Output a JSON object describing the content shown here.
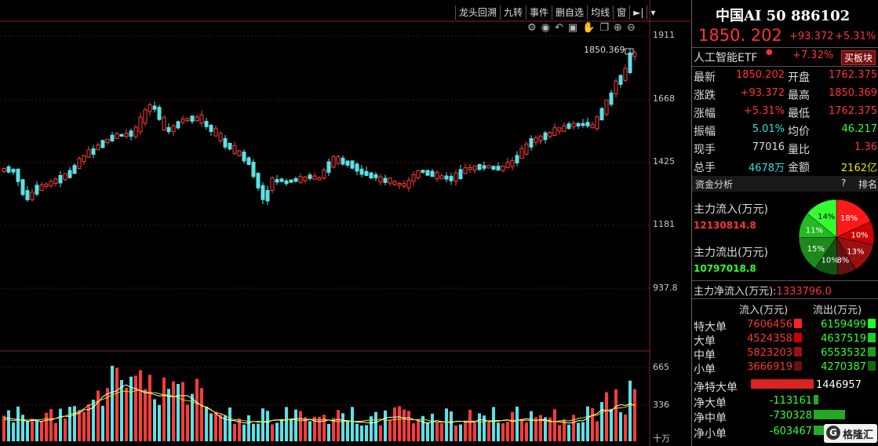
{
  "toolbar": {
    "items": [
      "龙头回溯",
      "九转",
      "事件",
      "删自选",
      "均线",
      "窗"
    ]
  },
  "price_axis": {
    "labels": [
      "1911",
      "1668",
      "1425",
      "1181",
      "937.8"
    ]
  },
  "volume_axis": {
    "labels": [
      "665",
      "336",
      "十万"
    ]
  },
  "chart_marks": {
    "high_label": "1850.369"
  },
  "header": {
    "title": "中国AI 50 886102",
    "price": "1850. 202",
    "change": "+93.372",
    "change_pct": "+5.31%"
  },
  "related": {
    "name": "人工智能ETF",
    "pct": "+7.32%",
    "button": "买板块"
  },
  "quote": [
    {
      "l1": "最新",
      "v1": "1850.202",
      "l2": "开盘",
      "v2": "1762.375"
    },
    {
      "l1": "涨跌",
      "v1": "+93.372",
      "l2": "最高",
      "v2": "1850.369"
    },
    {
      "l1": "涨幅",
      "v1": "+5.31%",
      "l2": "最低",
      "v2": "1762.375"
    },
    {
      "l1": "振幅",
      "v1": "5.01%",
      "l2": "均价",
      "v2": "46.217"
    },
    {
      "l1": "现手",
      "v1": "77016",
      "l2": "量比",
      "v2": "1.36"
    },
    {
      "l1": "总手",
      "v1": "4678万",
      "l2": "金额",
      "v2": "2162亿"
    }
  ],
  "fund": {
    "section_title": "资金分析",
    "help": "?",
    "rank": "排名",
    "inflow_label": "主力流入(万元)",
    "inflow_value": "12130814.8",
    "outflow_label": "主力流出(万元)",
    "outflow_value": "10797018.8",
    "net_label": "主力净流入(万元):",
    "net_value": "1333796.0",
    "pie": [
      {
        "label": "18%",
        "value": 18,
        "color": "#ff1a1a"
      },
      {
        "label": "10%",
        "value": 10,
        "color": "#cc0000"
      },
      {
        "label": "13%",
        "value": 13,
        "color": "#991111"
      },
      {
        "label": "8%",
        "value": 8,
        "color": "#661111"
      },
      {
        "label": "10%",
        "value": 10,
        "color": "#115511"
      },
      {
        "label": "15%",
        "value": 15,
        "color": "#1d8a1d"
      },
      {
        "label": "11%",
        "value": 11,
        "color": "#22bb22"
      },
      {
        "label": "14%",
        "value": 14,
        "color": "#33ff33"
      }
    ]
  },
  "flow_table": {
    "headers": [
      "流入(万元)",
      "流出(万元)"
    ],
    "rows": [
      {
        "label": "特大单",
        "in": "7606456",
        "out": "6159499",
        "in_color": "#ff2222",
        "out_color": "#22ff22"
      },
      {
        "label": "大单",
        "in": "4524358",
        "out": "4637519",
        "in_color": "#cc0000",
        "out_color": "#22cc22"
      },
      {
        "label": "中单",
        "in": "5823203",
        "out": "6553532",
        "in_color": "#991111",
        "out_color": "#1d9a1d"
      },
      {
        "label": "小单",
        "in": "3666919",
        "out": "4270387",
        "in_color": "#661111",
        "out_color": "#116611"
      }
    ]
  },
  "net_flows": [
    {
      "label": "净特大单",
      "value": "1446957",
      "amount": 1446957
    },
    {
      "label": "净大单",
      "value": "-113161",
      "amount": -113161
    },
    {
      "label": "净中单",
      "value": "-730328",
      "amount": -730328
    },
    {
      "label": "净小单",
      "value": "-603467",
      "amount": -603467
    }
  ],
  "watermark": "格隆汇"
}
